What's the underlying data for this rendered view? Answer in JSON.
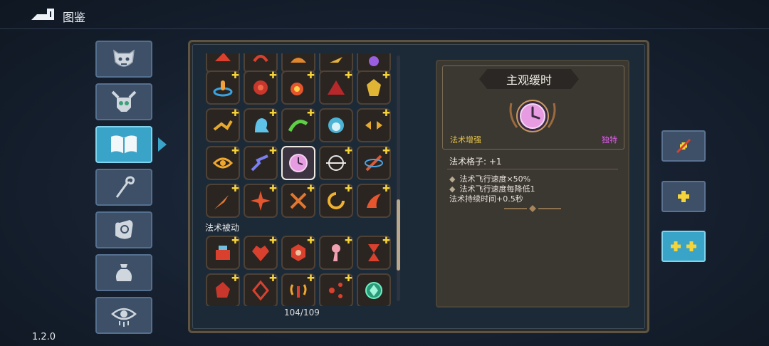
{
  "header": {
    "title": "图鉴",
    "version": "1.2.0"
  },
  "sidebar": {
    "items": [
      {
        "icon": "demon-mask-icon",
        "active": false
      },
      {
        "icon": "horned-skull-icon",
        "active": false
      },
      {
        "icon": "book-icon",
        "active": true
      },
      {
        "icon": "staff-icon",
        "active": false
      },
      {
        "icon": "spell-hand-icon",
        "active": false
      },
      {
        "icon": "pouch-icon",
        "active": false
      },
      {
        "icon": "eye-icon",
        "active": false
      }
    ]
  },
  "grid": {
    "section_label": "法术被动",
    "count": "104/109",
    "selected_icon": "clock-icon"
  },
  "detail": {
    "title": "主观缓时",
    "category": "法术增强",
    "rarity": "独特",
    "slot_text": "法术格子: +1",
    "effects": [
      "法术飞行速度×50%",
      "法术飞行速度每降低1",
      "法术持续时间+0.5秒"
    ]
  },
  "right_buttons": [
    {
      "icon": "remove-plus-icon",
      "active": false
    },
    {
      "icon": "single-plus-icon",
      "active": false
    },
    {
      "icon": "double-plus-icon",
      "active": true
    }
  ],
  "colors": {
    "accent": "#3aa3c8",
    "plus_yellow": "#f5d43a",
    "unique_pink": "#e05cf0",
    "enhance_gold": "#e8c64a"
  }
}
